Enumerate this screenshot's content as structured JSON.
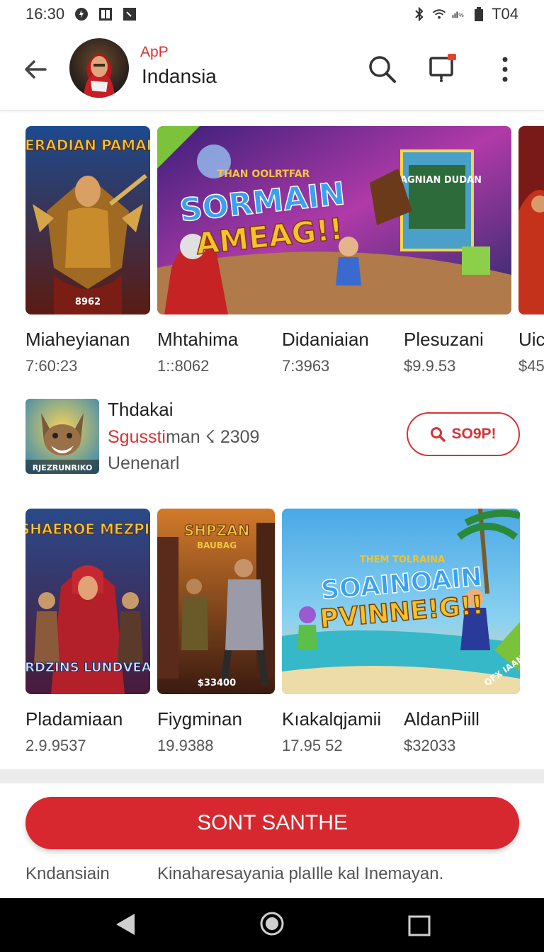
{
  "status_bar": {
    "time": "16:30",
    "battery": "T04"
  },
  "header": {
    "subtitle": "ApP",
    "title": "Indansia"
  },
  "row1": [
    {
      "title": "Miaheyianan",
      "price": "7:60:23",
      "art_title": "NERADIAN PAMAIA",
      "badge": "8962"
    },
    {
      "title": "Mhtahima",
      "price": "1::8062",
      "art_title": "SORMAIN",
      "art_title2": "AMEAG!!",
      "art_sub": "THAN OOLRTFAR",
      "poster_title": "NAGNIAN DUDAN"
    },
    {
      "title": "Didaniaian",
      "price": "7:3963"
    },
    {
      "title": "Plesuzani",
      "price": "$9.9.53"
    },
    {
      "title": "Uic",
      "price": "$45"
    }
  ],
  "featured": {
    "name": "Thdakai",
    "meta_highlight": "Sgussti",
    "meta_rest": "man ☇ 2309",
    "category": "Uenenarl",
    "icon_label": "RJEZRUNRIKO",
    "button_label": "SO9P!"
  },
  "row2": [
    {
      "title": "Pladamiaan",
      "price": "2.9.9537",
      "art_title": "SHAEROE MEZPI!",
      "art_bottom": "BRDZINS LUNDVEAS"
    },
    {
      "title": "Fiygminan",
      "price": "19.9388",
      "art_title": "SHPZAN",
      "art_sub": "BAUBAG",
      "badge": "$33400"
    },
    {
      "title": "Kıakalqjamii",
      "price": "17.95 52",
      "art_title": "SOAINOAIN",
      "art_title2": "PVINNE!G!!",
      "art_sub": "THEM TOLRAINA",
      "corner": "QFX IAAN"
    },
    {
      "title": "AldanPiill",
      "price": "$32033"
    }
  ],
  "primary_button": "SONT SANTHE",
  "footer": {
    "left": "Kndansiain",
    "right": "Kinaharesayania plaIlle kal Inemayan."
  },
  "colors": {
    "accent": "#d6282e",
    "text": "#222222",
    "muted": "#555555"
  }
}
